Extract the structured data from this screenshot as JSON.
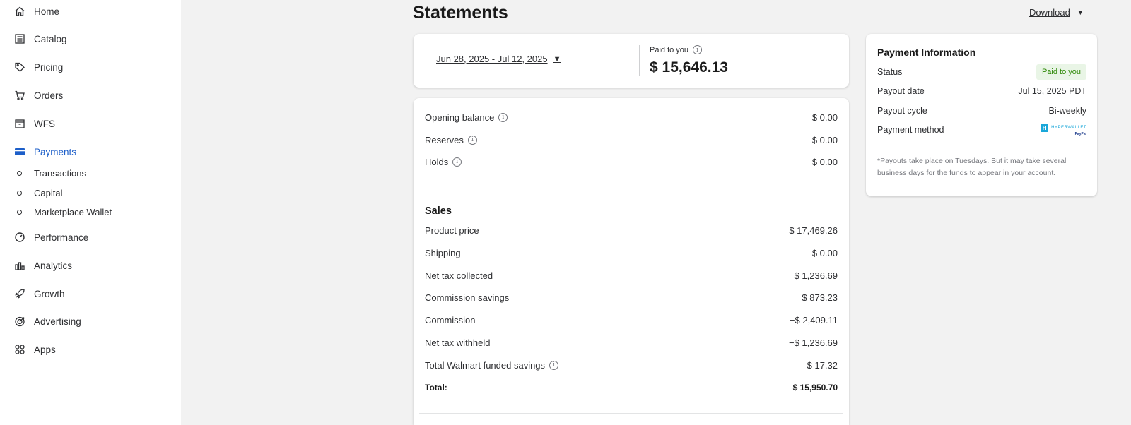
{
  "sidebar": {
    "items": [
      {
        "label": "Home",
        "icon": "home-icon"
      },
      {
        "label": "Catalog",
        "icon": "catalog-icon"
      },
      {
        "label": "Pricing",
        "icon": "tag-icon"
      },
      {
        "label": "Orders",
        "icon": "cart-icon"
      },
      {
        "label": "WFS",
        "icon": "box-icon"
      },
      {
        "label": "Payments",
        "icon": "card-icon",
        "active": true
      },
      {
        "label": "Performance",
        "icon": "gauge-icon"
      },
      {
        "label": "Analytics",
        "icon": "bar-chart-icon"
      },
      {
        "label": "Growth",
        "icon": "rocket-icon"
      },
      {
        "label": "Advertising",
        "icon": "target-icon"
      },
      {
        "label": "Apps",
        "icon": "grid-icon"
      }
    ],
    "sub_items": [
      "Transactions",
      "Capital",
      "Marketplace Wallet"
    ]
  },
  "header": {
    "title": "Statements",
    "download_label": "Download"
  },
  "summary": {
    "date_range": "Jun 28, 2025 - Jul 12, 2025",
    "paid_label": "Paid to you",
    "paid_amount": "$ 15,646.13"
  },
  "balances": [
    {
      "label": "Opening balance",
      "value": "$ 0.00",
      "info": true
    },
    {
      "label": "Reserves",
      "value": "$ 0.00",
      "info": true
    },
    {
      "label": "Holds",
      "value": "$ 0.00",
      "info": true
    }
  ],
  "sales": {
    "title": "Sales",
    "rows": [
      {
        "label": "Product price",
        "value": "$ 17,469.26"
      },
      {
        "label": "Shipping",
        "value": "$ 0.00"
      },
      {
        "label": "Net tax collected",
        "value": "$ 1,236.69"
      },
      {
        "label": "Commission savings",
        "value": "$ 873.23"
      },
      {
        "label": "Commission",
        "value": "−$ 2,409.11"
      },
      {
        "label": "Net tax withheld",
        "value": "−$ 1,236.69"
      },
      {
        "label": "Total Walmart funded savings",
        "value": "$ 17.32",
        "info": true
      }
    ],
    "total_label": "Total:",
    "total_value": "$ 15,950.70"
  },
  "payment_info": {
    "title": "Payment Information",
    "status_label": "Status",
    "status_value": "Paid to you",
    "payout_date_label": "Payout date",
    "payout_date_value": "Jul 15, 2025 PDT",
    "payout_cycle_label": "Payout cycle",
    "payout_cycle_value": "Bi-weekly",
    "method_label": "Payment method",
    "method_logo_name": "HYPERWALLET",
    "method_logo_sub": "PayPal",
    "note": "*Payouts take place on Tuesdays. But it may take several business days for the funds to appear in your account."
  },
  "colors": {
    "accent": "#1d5fc9",
    "badge_bg": "#e9f5e6",
    "badge_text": "#2a8703",
    "page_bg": "#f2f2f2"
  }
}
